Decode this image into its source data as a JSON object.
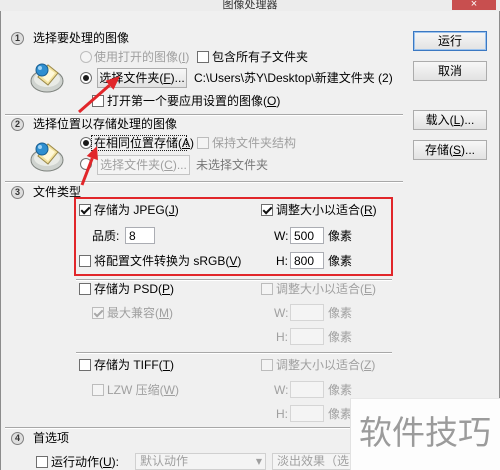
{
  "window": {
    "title": "图像处理器",
    "close_glyph": "×"
  },
  "actions": {
    "run": "运行",
    "cancel": "取消",
    "load": "载入(L)...",
    "save": "存储(S)..."
  },
  "icons": {
    "section1": "image-source-icon",
    "section2": "save-location-icon",
    "dropdown": "chevron-down-icon"
  },
  "section1": {
    "number": "1",
    "title": "选择要处理的图像",
    "use_open_images": {
      "label": "使用打开的图像(I)",
      "selected": false,
      "enabled": false
    },
    "include_subfolders": {
      "label": "包含所有子文件夹",
      "checked": false
    },
    "select_folder": {
      "label": "选择文件夹(F)...",
      "selected": true
    },
    "folder_path": "C:\\Users\\苏Y\\Desktop\\新建文件夹 (2)",
    "open_first_image": {
      "label": "打开第一个要应用设置的图像(O)",
      "checked": false
    }
  },
  "section2": {
    "number": "2",
    "title": "选择位置以存储处理的图像",
    "same_location": {
      "label": "在相同位置存储(A)",
      "selected": true
    },
    "keep_folder_structure": {
      "label": "保持文件夹结构",
      "checked": false,
      "enabled": false
    },
    "select_folder": {
      "label": "选择文件夹(C)...",
      "selected": false,
      "enabled": false
    },
    "folder_status": "未选择文件夹"
  },
  "section3": {
    "number": "3",
    "title": "文件类型",
    "width_label": "W:",
    "height_label": "H:",
    "pixel_unit": "像素",
    "jpeg": {
      "save_as": {
        "label": "存储为 JPEG(J)",
        "checked": true
      },
      "resize": {
        "label": "调整大小以适合(R)",
        "checked": true,
        "enabled": true
      },
      "quality_label": "品质:",
      "quality": "8",
      "width": "500",
      "height": "800",
      "convert_srgb": {
        "label": "将配置文件转换为 sRGB(V)",
        "checked": false
      }
    },
    "psd": {
      "save_as": {
        "label": "存储为 PSD(P)",
        "checked": false
      },
      "resize": {
        "label": "调整大小以适合(E)",
        "checked": false,
        "enabled": false
      },
      "max_compatibility": {
        "label": "最大兼容(M)",
        "checked": true,
        "enabled": false
      }
    },
    "tiff": {
      "save_as": {
        "label": "存储为 TIFF(T)",
        "checked": false
      },
      "resize": {
        "label": "调整大小以适合(Z)",
        "checked": false,
        "enabled": false
      },
      "lzw": {
        "label": "LZW 压缩(W)",
        "checked": false,
        "enabled": false
      }
    }
  },
  "section4": {
    "number": "4",
    "title": "首选项",
    "run_action": {
      "label": "运行动作(U):",
      "checked": false
    },
    "action_set": {
      "value": "默认动作",
      "enabled": false
    },
    "action": {
      "value": "淡出效果（选区",
      "enabled": false
    }
  },
  "watermark": "软件技巧",
  "colors": {
    "annotation": "#e1262a",
    "close_button": "#c84f4f",
    "default_button_border": "#3b78c2",
    "disabled_text": "#a0a0a0"
  }
}
